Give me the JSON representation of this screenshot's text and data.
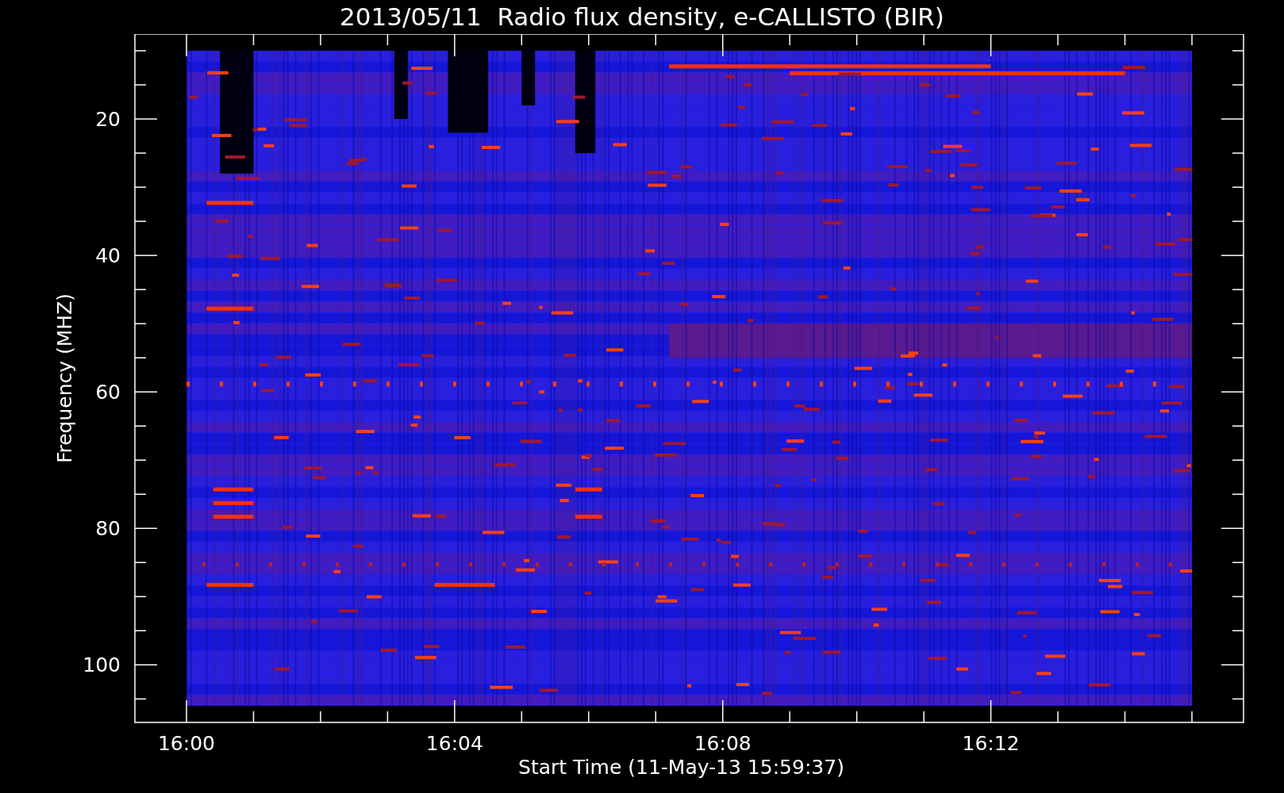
{
  "title": "2013/05/11  Radio flux density, e-CALLISTO (BIR)",
  "y_axis": {
    "label": "Frequency (MHZ)",
    "ticks": [
      "20",
      "40",
      "60",
      "80",
      "100"
    ]
  },
  "x_axis": {
    "label": "Start Time (11-May-13 15:59:37)",
    "ticks": [
      "16:00",
      "16:04",
      "16:08",
      "16:12"
    ]
  }
}
